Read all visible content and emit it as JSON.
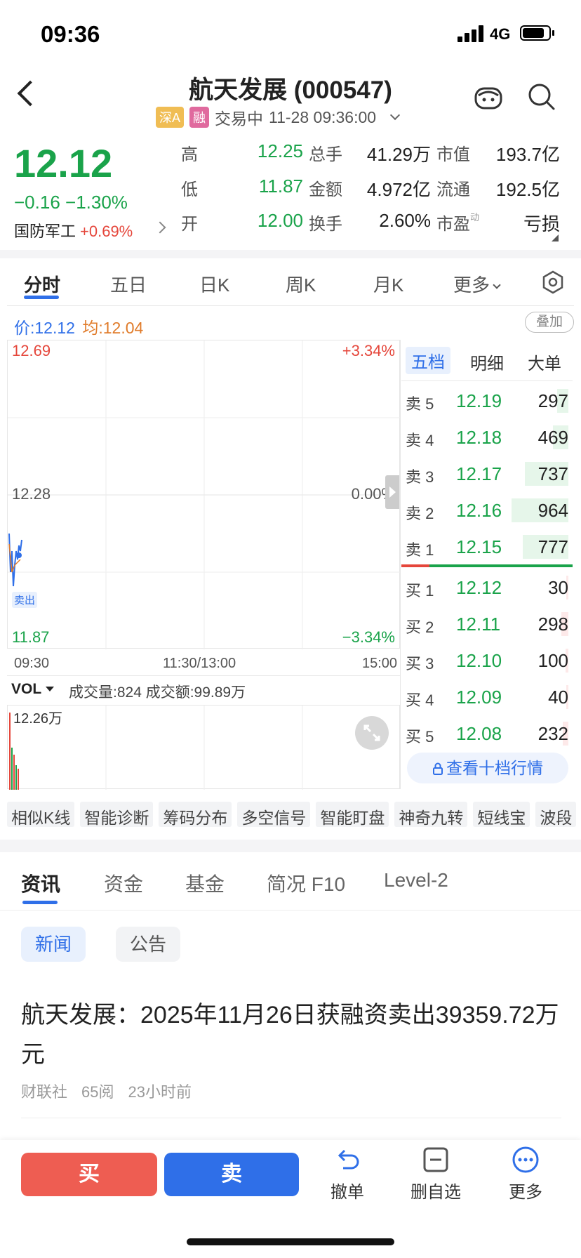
{
  "status": {
    "time": "09:36",
    "network": "4G"
  },
  "header": {
    "title": "航天发展 (000547)",
    "tag_market": "深A",
    "tag_margin": "融",
    "trading_status": "交易中",
    "datetime": "11-28 09:36:00"
  },
  "quote": {
    "price": "12.12",
    "change": "−0.16 −1.30%",
    "sector_name": "国防军工",
    "sector_change": "+0.69%",
    "stats": [
      {
        "label": "高",
        "value": "12.25",
        "label2": "总手",
        "value2": "41.29万",
        "label3": "市值",
        "value3": "193.7亿"
      },
      {
        "label": "低",
        "value": "11.87",
        "label2": "金额",
        "value2": "4.972亿",
        "label3": "流通",
        "value3": "192.5亿"
      },
      {
        "label": "开",
        "value": "12.00",
        "label2": "换手",
        "value2": "2.60%",
        "label3": "市盈",
        "label3_sup": "动",
        "value3": "亏损"
      }
    ]
  },
  "chart_tabs": [
    "分时",
    "五日",
    "日K",
    "周K",
    "月K",
    "更多"
  ],
  "chart": {
    "price_label": "价:",
    "price": "12.12",
    "avg_label": "均:",
    "avg": "12.04",
    "overlay": "叠加",
    "y_top": "12.69",
    "y_mid": "12.28",
    "y_bot": "11.87",
    "pct_top": "+3.34%",
    "pct_mid": "0.00%",
    "pct_bot": "−3.34%",
    "t_start": "09:30",
    "t_mid": "11:30/13:00",
    "t_end": "15:00",
    "sell_marker": "卖出"
  },
  "orderbook": {
    "tabs": [
      "五档",
      "明细",
      "大单"
    ],
    "asks": [
      {
        "label": "卖 5",
        "price": "12.19",
        "vol": "297",
        "bar": 0.16
      },
      {
        "label": "卖 4",
        "price": "12.18",
        "vol": "469",
        "bar": 0.22
      },
      {
        "label": "卖 3",
        "price": "12.17",
        "vol": "737",
        "bar": 0.62
      },
      {
        "label": "卖 2",
        "price": "12.16",
        "vol": "964",
        "bar": 0.81
      },
      {
        "label": "卖 1",
        "price": "12.15",
        "vol": "777",
        "bar": 0.65
      }
    ],
    "bids": [
      {
        "label": "买 1",
        "price": "12.12",
        "vol": "30",
        "bar": 0.03
      },
      {
        "label": "买 2",
        "price": "12.11",
        "vol": "298",
        "bar": 0.1
      },
      {
        "label": "买 3",
        "price": "12.10",
        "vol": "100",
        "bar": 0.04
      },
      {
        "label": "买 4",
        "price": "12.09",
        "vol": "40",
        "bar": 0.03
      },
      {
        "label": "买 5",
        "price": "12.08",
        "vol": "232",
        "bar": 0.08
      }
    ],
    "ten_level": "查看十档行情"
  },
  "volume": {
    "indicator": "VOL",
    "info": "成交量:824 成交额:99.89万",
    "max_label": "12.26万"
  },
  "tools": [
    "相似K线",
    "智能诊断",
    "筹码分布",
    "多空信号",
    "智能盯盘",
    "神奇九转",
    "短线宝",
    "波段"
  ],
  "info_tabs": [
    "资讯",
    "资金",
    "基金",
    "简况 F10",
    "Level-2"
  ],
  "news_filters": [
    "新闻",
    "公告"
  ],
  "news": {
    "title": "航天发展：2025年11月26日获融资卖出39359.72万元",
    "source": "财联社",
    "reads": "65阅",
    "time": "23小时前"
  },
  "bottom": {
    "buy": "买",
    "sell": "卖",
    "cancel": "撤单",
    "delete_watch": "删自选",
    "more": "更多"
  },
  "colors": {
    "up": "#e5463b",
    "down": "#1aa34a",
    "accent": "#2f6fe8"
  }
}
